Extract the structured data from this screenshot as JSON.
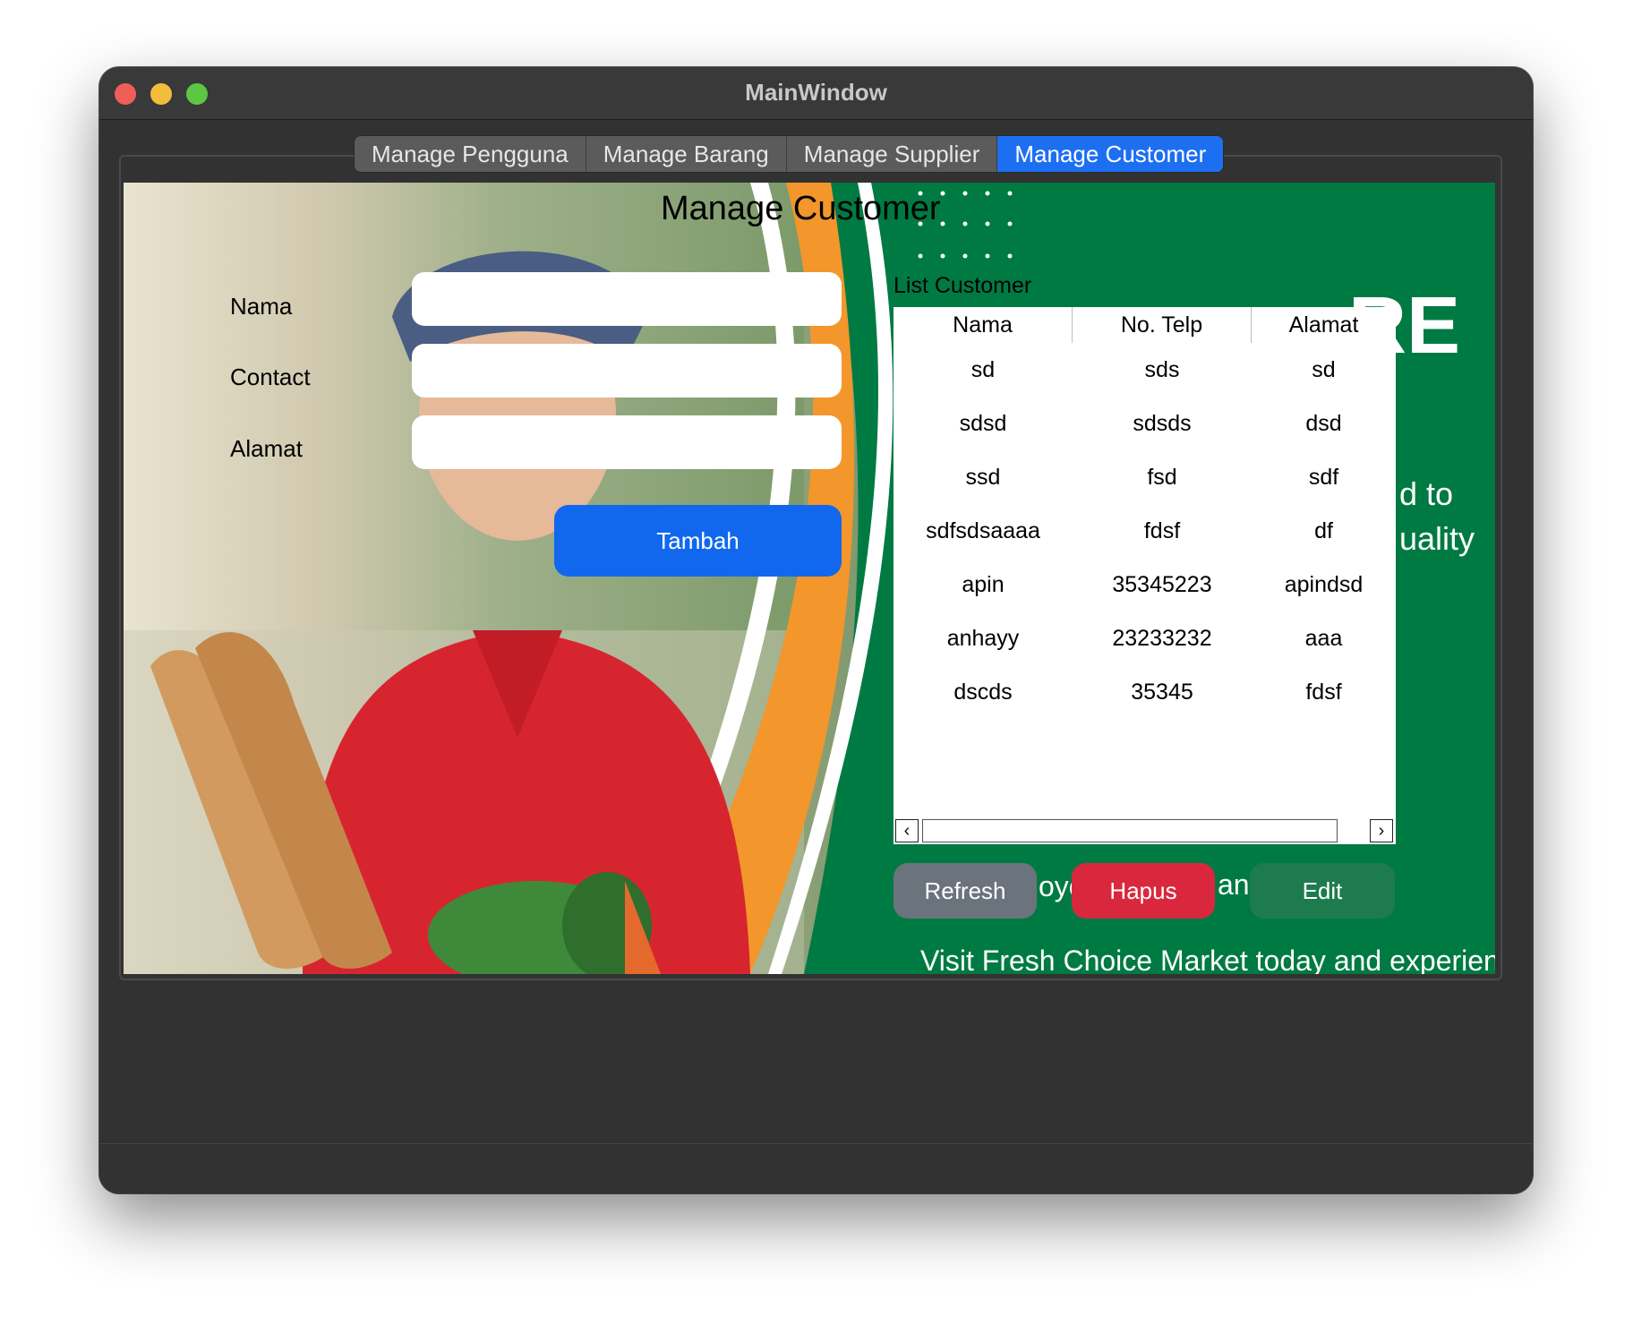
{
  "window": {
    "title": "MainWindow"
  },
  "tabs": [
    {
      "label": "Manage Pengguna"
    },
    {
      "label": "Manage Barang"
    },
    {
      "label": "Manage Supplier"
    },
    {
      "label": "Manage Customer",
      "active": true
    }
  ],
  "page": {
    "heading": "Manage Customer",
    "background_text": [
      "RE",
      "d to",
      "uality",
      "oyc",
      "anc",
      "Visit Fresh Choice Market today and experience the"
    ]
  },
  "form": {
    "nama_label": "Nama",
    "contact_label": "Contact",
    "alamat_label": "Alamat",
    "nama_value": "",
    "contact_value": "",
    "alamat_value": "",
    "tambah_label": "Tambah"
  },
  "list": {
    "caption": "List Customer",
    "columns": [
      "Nama",
      "No. Telp",
      "Alamat"
    ],
    "rows": [
      [
        "sd",
        "sds",
        "sd"
      ],
      [
        "sdsd",
        "sdsds",
        "dsd"
      ],
      [
        "ssd",
        "fsd",
        "sdf"
      ],
      [
        "sdfsdsaaaa",
        "fdsf",
        "df"
      ],
      [
        "apin",
        "35345223",
        "apindsd"
      ],
      [
        "anhayy",
        "23233232",
        "aaa"
      ],
      [
        "dscds",
        "35345",
        "fdsf"
      ]
    ]
  },
  "actions": {
    "refresh_label": "Refresh",
    "hapus_label": "Hapus",
    "edit_label": "Edit"
  },
  "colors": {
    "active_tab": "#1d6ff2",
    "tambah": "#1168ee",
    "refresh": "#6b737d",
    "hapus": "#d9283e",
    "edit": "#1e7b4e",
    "banner_green": "#007a43",
    "banner_orange": "#f3962b"
  }
}
